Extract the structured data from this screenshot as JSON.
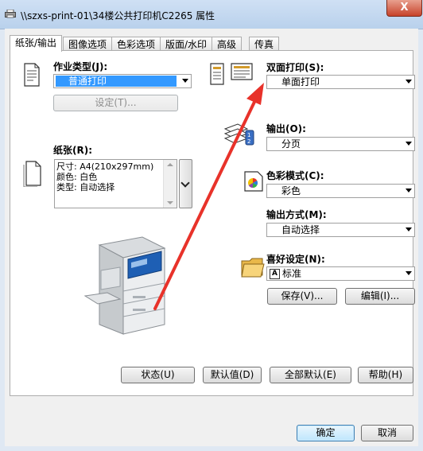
{
  "window": {
    "title": "\\\\szxs-print-01\\34楼公共打印机C2265 属性",
    "close_label": "X"
  },
  "tabs": [
    {
      "label": "纸张/输出",
      "active": true
    },
    {
      "label": "图像选项"
    },
    {
      "label": "色彩选项"
    },
    {
      "label": "版面/水印"
    },
    {
      "label": "高级"
    },
    {
      "label": "传真"
    }
  ],
  "left": {
    "job_type_label": "作业类型(J):",
    "job_type_value": "普通打印",
    "settings_button": "设定(T)...",
    "paper_label": "纸张(R):",
    "paper_lines": [
      "尺寸: A4(210x297mm)",
      "颜色: 白色",
      "类型: 自动选择"
    ]
  },
  "right": {
    "duplex_label": "双面打印(S):",
    "duplex_value": "单面打印",
    "output_label": "输出(O):",
    "output_value": "分页",
    "color_mode_label": "色彩模式(C):",
    "color_mode_value": "彩色",
    "output_method_label": "输出方式(M):",
    "output_method_value": "自动选择",
    "favorites_label": "喜好设定(N):",
    "favorites_value": "标准",
    "favorites_prefix": "A",
    "save_button": "保存(V)...",
    "edit_button": "编辑(I)..."
  },
  "bottom_buttons": {
    "status": "状态(U)",
    "defaults": "默认值(D)",
    "all_defaults": "全部默认(E)",
    "help": "帮助(H)"
  },
  "dialog_buttons": {
    "ok": "确定",
    "cancel": "取消"
  },
  "colors": {
    "annotation_arrow": "#e8322a",
    "selection": "#3399ff",
    "printer_accent": "#1e5fb4"
  },
  "icons": [
    "printer-icon",
    "document-icon",
    "paper-icon",
    "duplex-icon",
    "output-stack-icon",
    "color-mode-icon",
    "folder-icon",
    "printer-illustration"
  ]
}
